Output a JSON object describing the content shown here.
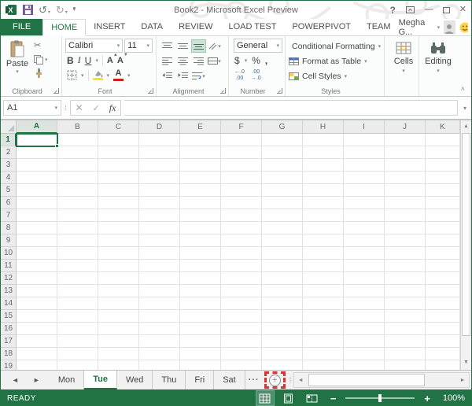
{
  "window": {
    "title": "Book2 - Microsoft Excel Preview"
  },
  "ribbon_tabs": [
    {
      "label": "FILE"
    },
    {
      "label": "HOME"
    },
    {
      "label": "INSERT"
    },
    {
      "label": "DATA"
    },
    {
      "label": "REVIEW"
    },
    {
      "label": "LOAD TEST"
    },
    {
      "label": "POWERPIVOT"
    },
    {
      "label": "TEAM"
    }
  ],
  "account": {
    "name": "Megha G..."
  },
  "ribbon": {
    "clipboard": {
      "label": "Clipboard",
      "paste": "Paste"
    },
    "font": {
      "label": "Font",
      "family": "Calibri",
      "size": "11",
      "bold": "B",
      "italic": "I",
      "underline": "U",
      "grow_font": "A",
      "shrink_font": "A",
      "font_color": "A"
    },
    "alignment": {
      "label": "Alignment"
    },
    "number": {
      "label": "Number",
      "format": "General",
      "currency": "$",
      "percent": "%",
      "comma": ",",
      "inc_dec_top": "←.0",
      "inc_dec_bottom": ".00",
      "dec_dec_top": ".00",
      "dec_dec_bottom": "→.0"
    },
    "styles": {
      "label": "Styles",
      "items": [
        "Conditional Formatting",
        "Format as Table",
        "Cell Styles"
      ]
    },
    "cells": {
      "label": "Cells"
    },
    "editing": {
      "label": "Editing"
    }
  },
  "formula_bar": {
    "name_box": "A1",
    "fx": "fx",
    "value": ""
  },
  "grid": {
    "columns": [
      "A",
      "B",
      "C",
      "D",
      "E",
      "F",
      "G",
      "H",
      "I",
      "J",
      "K"
    ],
    "row_count": 19,
    "selected_cell": "A1",
    "selected_column": "A",
    "selected_row": 1
  },
  "sheet_bar": {
    "tabs": [
      {
        "label": "Mon"
      },
      {
        "label": "Tue",
        "active": true
      },
      {
        "label": "Wed"
      },
      {
        "label": "Thu"
      },
      {
        "label": "Fri"
      },
      {
        "label": "Sat"
      }
    ],
    "more": "···"
  },
  "status_bar": {
    "mode": "READY",
    "zoom": "100%"
  },
  "colors": {
    "excel_green": "#217346",
    "fill_yellow": "#ffe115",
    "font_red": "#d21b1b",
    "annotation_red": "#d23333"
  }
}
